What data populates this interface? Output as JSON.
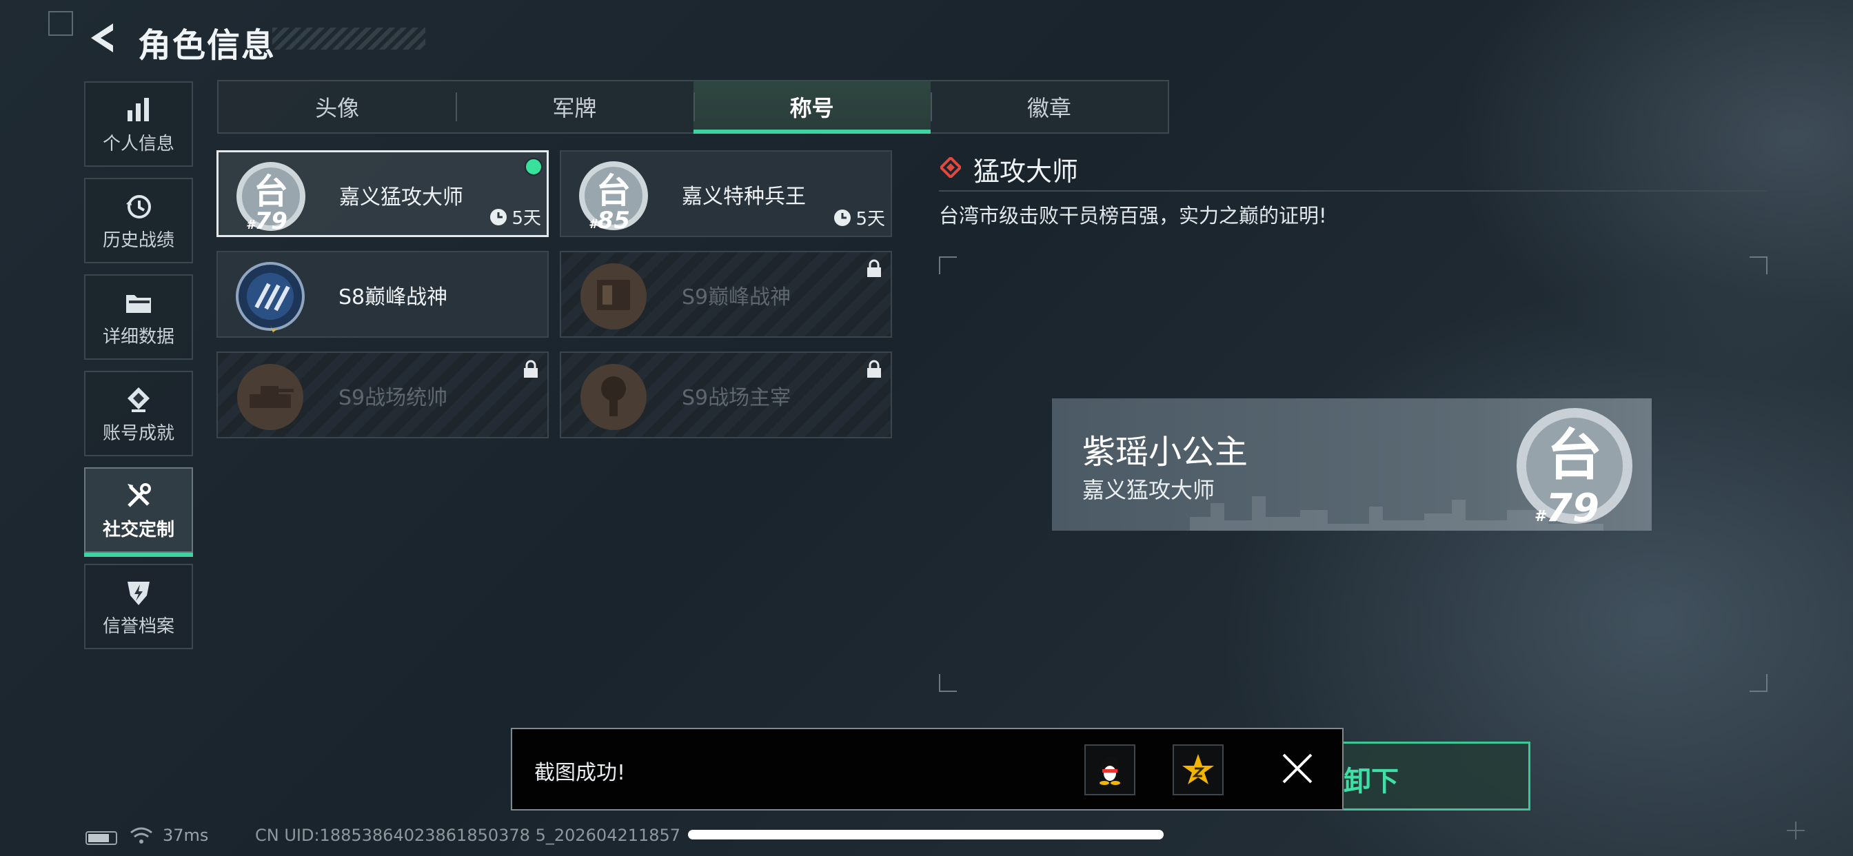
{
  "header": {
    "title": "角色信息"
  },
  "sidebar": {
    "items": [
      {
        "label": "个人信息",
        "icon": "bar-chart-icon"
      },
      {
        "label": "历史战绩",
        "icon": "history-clock-icon"
      },
      {
        "label": "详细数据",
        "icon": "folder-icon"
      },
      {
        "label": "账号成就",
        "icon": "achievement-badge-icon"
      },
      {
        "label": "社交定制",
        "icon": "tools-icon",
        "active": true
      },
      {
        "label": "信誉档案",
        "icon": "credit-shield-icon"
      }
    ]
  },
  "tabs": [
    {
      "label": "头像"
    },
    {
      "label": "军牌"
    },
    {
      "label": "称号",
      "active": true
    },
    {
      "label": "徽章"
    }
  ],
  "titles": [
    {
      "name": "嘉义猛攻大师",
      "rank_prefix": "#",
      "rank": "79",
      "timer": "5天",
      "selected": true,
      "equipped": true,
      "locked": false
    },
    {
      "name": "嘉义特种兵王",
      "rank_prefix": "#",
      "rank": "85",
      "timer": "5天",
      "selected": false,
      "locked": false
    },
    {
      "name": "S8巅峰战神",
      "locked": false
    },
    {
      "name": "S9巅峰战神",
      "locked": true
    },
    {
      "name": "S9战场统帅",
      "locked": true
    },
    {
      "name": "S9战场主宰",
      "locked": true
    }
  ],
  "detail": {
    "title": "猛攻大师",
    "description": "台湾市级击败干员榜百强，实力之巅的证明!"
  },
  "nameplate": {
    "player_name": "紫瑶小公主",
    "title": "嘉义猛攻大师",
    "emblem_char": "台",
    "rank_prefix": "#",
    "rank": "79"
  },
  "emblem_char": "台",
  "toast": {
    "message": "截图成功!",
    "share_icons": [
      "qq-icon",
      "qzone-star-icon"
    ]
  },
  "action_button": {
    "label": "卸下"
  },
  "status": {
    "ping": "37ms",
    "uid": "CN UID:18853864023861850378 5_202604211857"
  },
  "colors": {
    "accent": "#3fd3a0",
    "accent_text": "#3fe0a6",
    "equipped_dot": "#38e29d",
    "diamond": "#e0493f"
  }
}
